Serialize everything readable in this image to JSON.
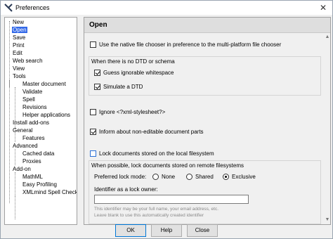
{
  "window": {
    "title": "Preferences",
    "close_glyph": "✕"
  },
  "tree": {
    "items": [
      {
        "label": "New"
      },
      {
        "label": "Open",
        "selected": true
      },
      {
        "label": "Save"
      },
      {
        "label": "Print"
      },
      {
        "label": "Edit"
      },
      {
        "label": "Web search"
      },
      {
        "label": "View"
      },
      {
        "label": "Tools"
      },
      {
        "label": "Master document"
      },
      {
        "label": "Validate"
      },
      {
        "label": "Spell"
      },
      {
        "label": "Revisions"
      },
      {
        "label": "Helper applications"
      },
      {
        "label": "Install add-ons"
      },
      {
        "label": "General"
      },
      {
        "label": "Features"
      },
      {
        "label": "Advanced"
      },
      {
        "label": "Cached data"
      },
      {
        "label": "Proxies"
      },
      {
        "label": "Add-on"
      },
      {
        "label": "MathML"
      },
      {
        "label": "Easy Profiling"
      },
      {
        "label": "XMLmind Spell Checker"
      }
    ]
  },
  "panel": {
    "heading": "Open",
    "native_chooser": {
      "label": "Use the native file chooser in preference to the multi-platform file chooser",
      "checked": false
    },
    "dtd_group": {
      "title": "When there is no DTD or schema",
      "guess": {
        "label": "Guess ignorable whitespace",
        "checked": true
      },
      "simulate": {
        "label": "Simulate a DTD",
        "checked": true
      }
    },
    "ignore_stylesheet": {
      "label": "Ignore <?xml-stylesheet?>",
      "checked": false
    },
    "inform": {
      "label": "Inform about non-editable document parts",
      "checked": true
    },
    "lock_local": {
      "label": "Lock documents stored on the local filesystem",
      "checked": false
    },
    "remote_group": {
      "title": "When possible, lock documents stored on remote filesystems",
      "mode_label": "Preferred lock mode:",
      "modes": [
        {
          "label": "None",
          "selected": false
        },
        {
          "label": "Shared",
          "selected": false
        },
        {
          "label": "Exclusive",
          "selected": true
        }
      ],
      "owner_label": "Identifier as a lock owner:",
      "owner_value": "",
      "note_line1": "This identifier may be your full name, your email address, etc.",
      "note_line2": "Leave blank to use this automatically created identifier"
    }
  },
  "buttons": {
    "ok": "OK",
    "help": "Help",
    "close": "Close"
  },
  "colors": {
    "selection": "#3369e8",
    "focus": "#0078d7"
  }
}
